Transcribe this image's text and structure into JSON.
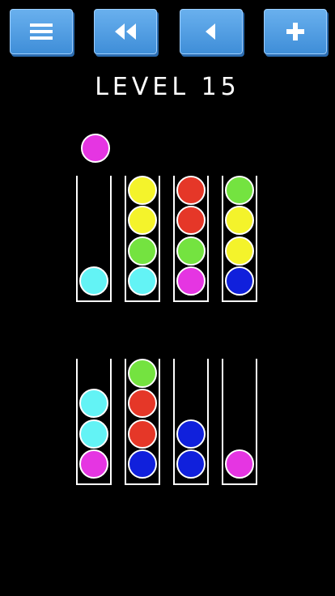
{
  "toolbar": {
    "menu_icon": "hamburger-icon",
    "restart_icon": "double-rewind-icon",
    "undo_icon": "play-back-icon",
    "add_icon": "plus-icon"
  },
  "level": {
    "title": "LEVEL 15"
  },
  "colors": {
    "magenta": "#e535e2",
    "cyan": "#63f3f5",
    "yellow": "#f4f32b",
    "green": "#74e340",
    "red": "#e53728",
    "blue": "#1020dc",
    "button": "#4d9be3"
  },
  "held_ball": "magenta",
  "tubes": [
    [
      "cyan"
    ],
    [
      "cyan",
      "green",
      "yellow",
      "yellow"
    ],
    [
      "magenta",
      "green",
      "red",
      "red"
    ],
    [
      "blue",
      "yellow",
      "yellow",
      "green"
    ],
    [
      "magenta",
      "cyan",
      "cyan"
    ],
    [
      "blue",
      "red",
      "red",
      "green"
    ],
    [
      "blue",
      "blue"
    ],
    [
      "magenta"
    ]
  ]
}
